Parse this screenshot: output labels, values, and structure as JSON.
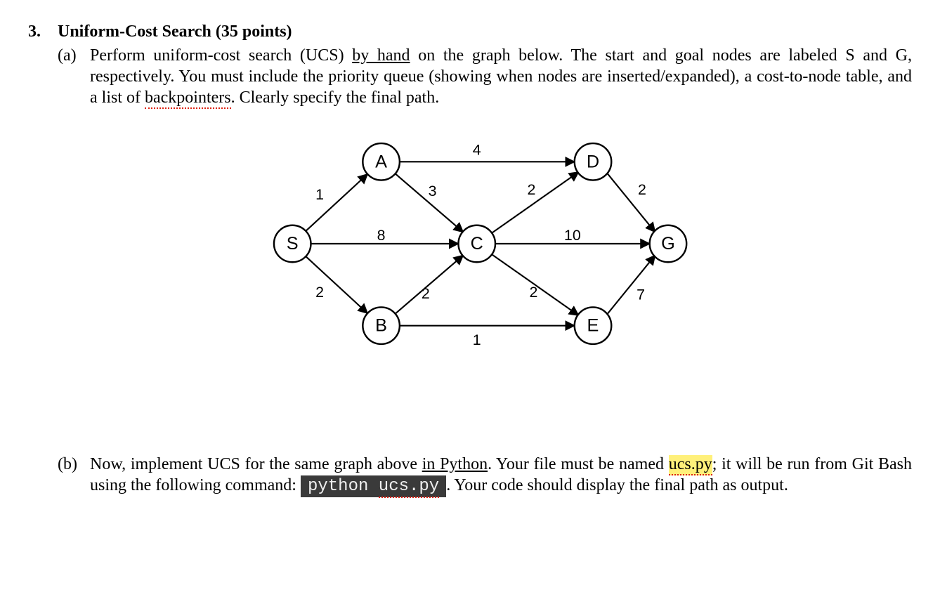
{
  "question": {
    "number": "3.",
    "title": "Uniform-Cost Search (35 points)"
  },
  "part_a": {
    "label": "(a)",
    "t1": "Perform uniform-cost search (UCS) ",
    "u1": "by hand",
    "t2": " on the graph below. The start and goal nodes are labeled S and G, respectively. You must include the priority queue (showing when nodes are inserted/expanded), a cost-to-node table, and a list of ",
    "sp1": "backpointers",
    "t3": ". Clearly specify the final path."
  },
  "part_b": {
    "label": "(b)",
    "t1": "Now, implement UCS for the same graph above ",
    "u1": "in Python",
    "t2": ". Your file must be named ",
    "hl_sp": "ucs.py",
    "t3": "; it will be run from Git Bash using the following command: ",
    "cmd_p": "python  ",
    "cmd_sp": "ucs.py",
    "t4": ". Your code should display the final path as output."
  },
  "graph": {
    "nodes": {
      "S": "S",
      "A": "A",
      "B": "B",
      "C": "C",
      "D": "D",
      "E": "E",
      "G": "G"
    },
    "weights": {
      "SA": "1",
      "SC": "8",
      "SB": "2",
      "AD": "4",
      "AC": "3",
      "BC": "2",
      "BE": "1",
      "CD": "2",
      "CE": "2",
      "CG": "10",
      "DG": "2",
      "EG": "7"
    }
  }
}
